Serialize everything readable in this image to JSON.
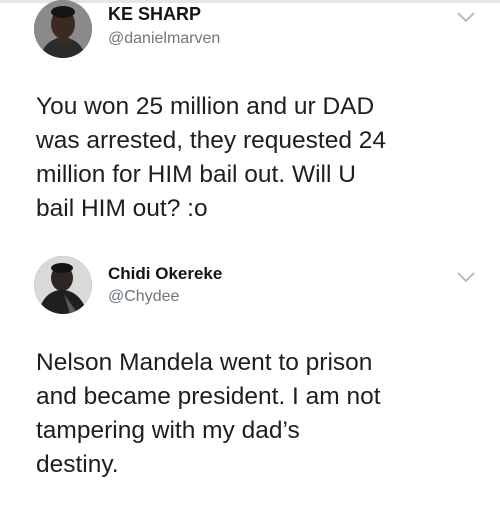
{
  "tweets": [
    {
      "name": "KE SHARP",
      "handle": "@danielmarven",
      "avatar_icon": "user-avatar-photo",
      "menu_icon": "chevron-down-icon",
      "text_lines": [
        "You won 25 million and ur DAD",
        "was arrested, they requested 24",
        "million for HIM bail out. Will U",
        "bail HIM out? :o"
      ]
    },
    {
      "name": "Chidi Okereke",
      "handle": "@Chydee",
      "avatar_icon": "user-avatar-photo",
      "menu_icon": "chevron-down-icon",
      "text_lines": [
        "Nelson Mandela went to prison",
        "and became president. I am not",
        "tampering with my dad’s",
        "destiny."
      ]
    }
  ],
  "colors": {
    "text": "#1e1e1e",
    "handle": "#6e767d",
    "chevron": "#b8bcc0"
  }
}
